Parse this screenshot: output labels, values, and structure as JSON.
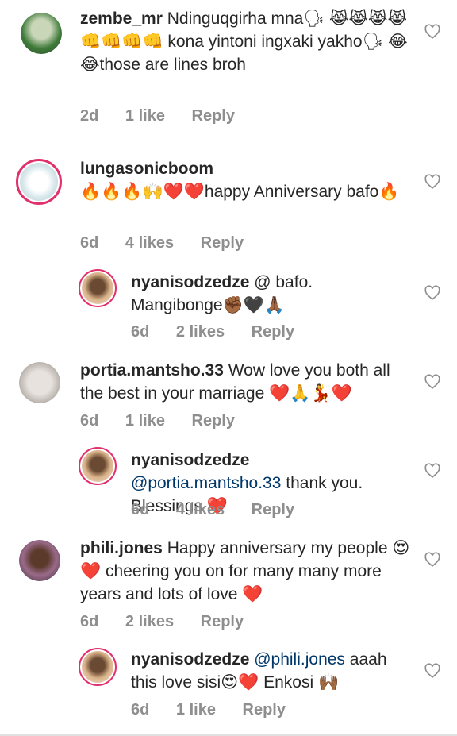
{
  "comments": [
    {
      "username": "zembe_mr",
      "text": "Ndinguqgirha mna🗣 😹😹😹😹👊👊👊👊 kona yintoni ingxaki yakho🗣 😂😂those are lines broh",
      "age": "2d",
      "likes": "1 like",
      "reply": "Reply"
    },
    {
      "username": "lungasonicboom",
      "text": "🔥🔥🔥🙌❤️❤️happy Anniversary bafo🔥",
      "age": "6d",
      "likes": "4 likes",
      "reply": "Reply"
    },
    {
      "username": "nyanisodzedze",
      "mention": "",
      "text": "@ bafo. Mangibonge✊🏾🖤🙏🏾",
      "age": "6d",
      "likes": "2 likes",
      "reply": "Reply"
    },
    {
      "username": "portia.mantsho.33",
      "text": "Wow love you both all the best in your marriage ❤️🙏💃❤️",
      "age": "6d",
      "likes": "1 like",
      "reply": "Reply"
    },
    {
      "username": "nyanisodzedze",
      "mention": "@portia.mantsho.33",
      "text": "thank you. Blessings ❤️",
      "age": "6d",
      "likes": "4 likes",
      "reply": "Reply"
    },
    {
      "username": "phili.jones",
      "text": "Happy anniversary my people 😍❤️ cheering you on for many many more years and lots of love ❤️",
      "age": "6d",
      "likes": "2 likes",
      "reply": "Reply"
    },
    {
      "username": "nyanisodzedze",
      "mention": "@phili.jones",
      "text": "aaah this love sisi😍❤️ Enkosi 🙌🏾",
      "age": "6d",
      "likes": "1 like",
      "reply": "Reply"
    }
  ],
  "colors": {
    "accent_ring": "#e1306c",
    "mention": "#00376b",
    "meta": "#8e8e8e"
  },
  "icons": {
    "like": "heart-outline-icon"
  }
}
